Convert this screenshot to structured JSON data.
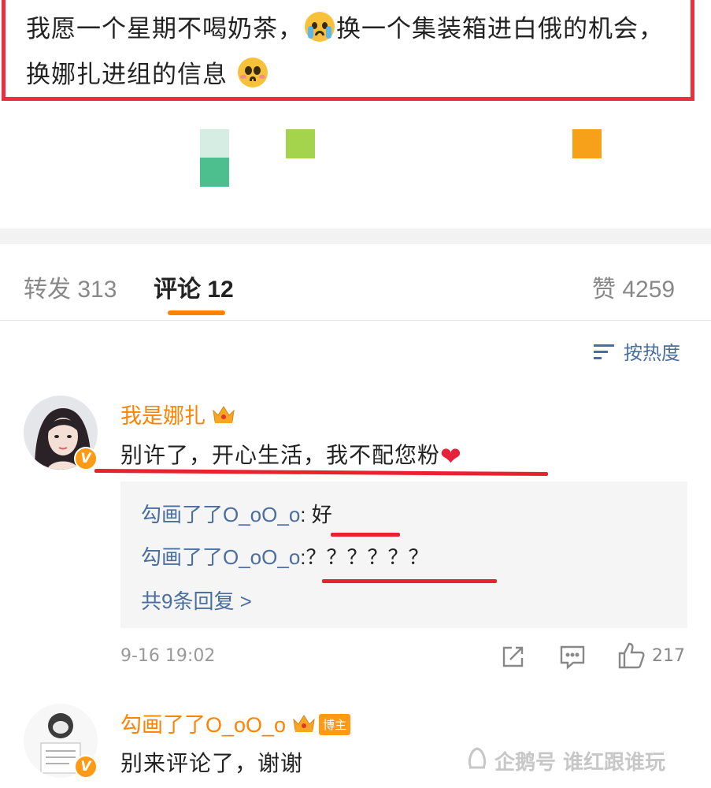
{
  "post": {
    "text_part1": "我愿一个星期不喝奶茶，",
    "text_part2": "换一个集装箱进白俄的机会，换娜扎进组的信息"
  },
  "colors": {
    "highlight_red": "#ee2d3e",
    "accent_orange": "#ff8200",
    "link_blue": "#4a6ea0",
    "squares": [
      "#d6ede3",
      "#4dbf8e",
      "#a3d44b",
      "#f7a11a"
    ]
  },
  "tabs": {
    "repost_label": "转发",
    "repost_count": "313",
    "comment_label": "评论",
    "comment_count": "12",
    "like_label": "赞",
    "like_count": "4259"
  },
  "sort": {
    "label": "按热度"
  },
  "comment1": {
    "username": "我是娜扎",
    "badge": "V",
    "text": "别许了，开心生活，我不配您粉",
    "replies": [
      {
        "user": "勾画了了O_oO_o",
        "text": "好"
      },
      {
        "user": "勾画了了O_oO_o",
        "text": "？？？？？？"
      }
    ],
    "more_replies": "共9条回复 >",
    "timestamp": "9-16 19:02",
    "like_count": "217"
  },
  "comment2": {
    "username": "勾画了了O_oO_o",
    "tag": "博主",
    "badge": "V",
    "text": "别来评论了，谢谢"
  },
  "watermark": {
    "text": "企鹅号 谁红跟谁玩"
  }
}
